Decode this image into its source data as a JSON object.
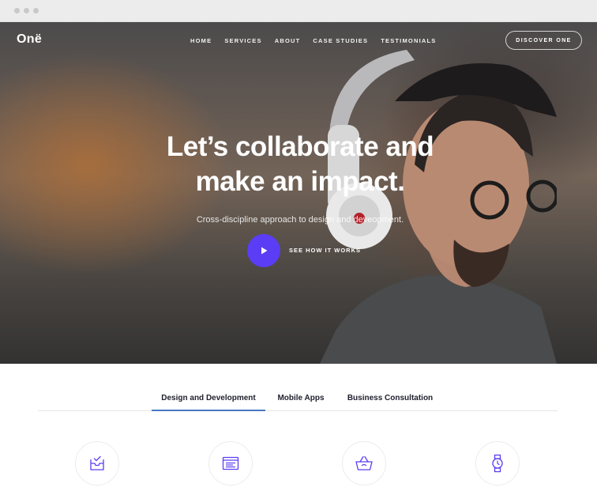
{
  "brand": {
    "logo": "Onë",
    "accent_color": "#5a3df4"
  },
  "nav": {
    "items": [
      "HOME",
      "SERVICES",
      "ABOUT",
      "CASE STUDIES",
      "TESTIMONIALS"
    ],
    "cta": "DISCOVER ONE"
  },
  "hero": {
    "headline_line1": "Let’s collaborate and",
    "headline_line2": "make an impact.",
    "subtitle": "Cross-discipline approach to design and deveopment.",
    "video_cta": "SEE HOW IT WORKS"
  },
  "tabs": {
    "items": [
      "Design and Development",
      "Mobile Apps",
      "Business Consultation"
    ],
    "active": "Design and Development"
  },
  "features": {
    "icons": [
      "inbox-check-icon",
      "browser-window-icon",
      "shopping-basket-icon",
      "wristwatch-icon"
    ]
  }
}
